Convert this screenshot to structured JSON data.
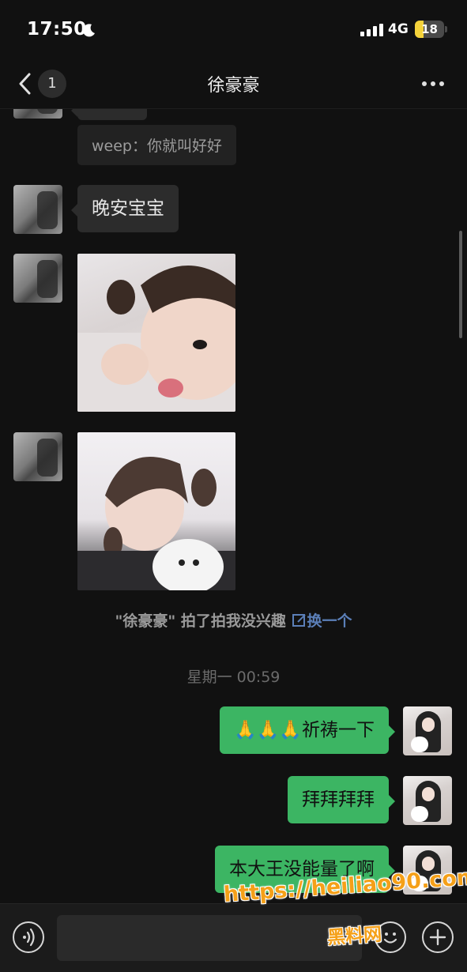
{
  "status_bar": {
    "time": "17:50",
    "network": "4G",
    "battery_level": "18",
    "icons": [
      "moon-icon",
      "signal-icon",
      "battery-icon"
    ]
  },
  "nav": {
    "unread_count": "1",
    "title": "徐豪豪",
    "icons": [
      "back-chevron-icon",
      "more-icon"
    ]
  },
  "messages": {
    "quote": "weep：你就叫好好",
    "goodnight": "晚安宝宝",
    "pat_note": "\"徐豪豪\" 拍了拍我没兴趣",
    "pat_edit": "换一个",
    "timestamp": "星期一 00:59",
    "self_1": "🙏🙏🙏祈祷一下",
    "self_2": "拜拜拜拜",
    "self_3": "本大王没能量了啊"
  },
  "watermark": {
    "url": "https://heiliao90.com",
    "name": "黑料网"
  },
  "colors": {
    "background": "#111111",
    "bubble_self": "#3cb563",
    "bubble_other": "#2c2c2c",
    "watermark": "#f5a018"
  }
}
